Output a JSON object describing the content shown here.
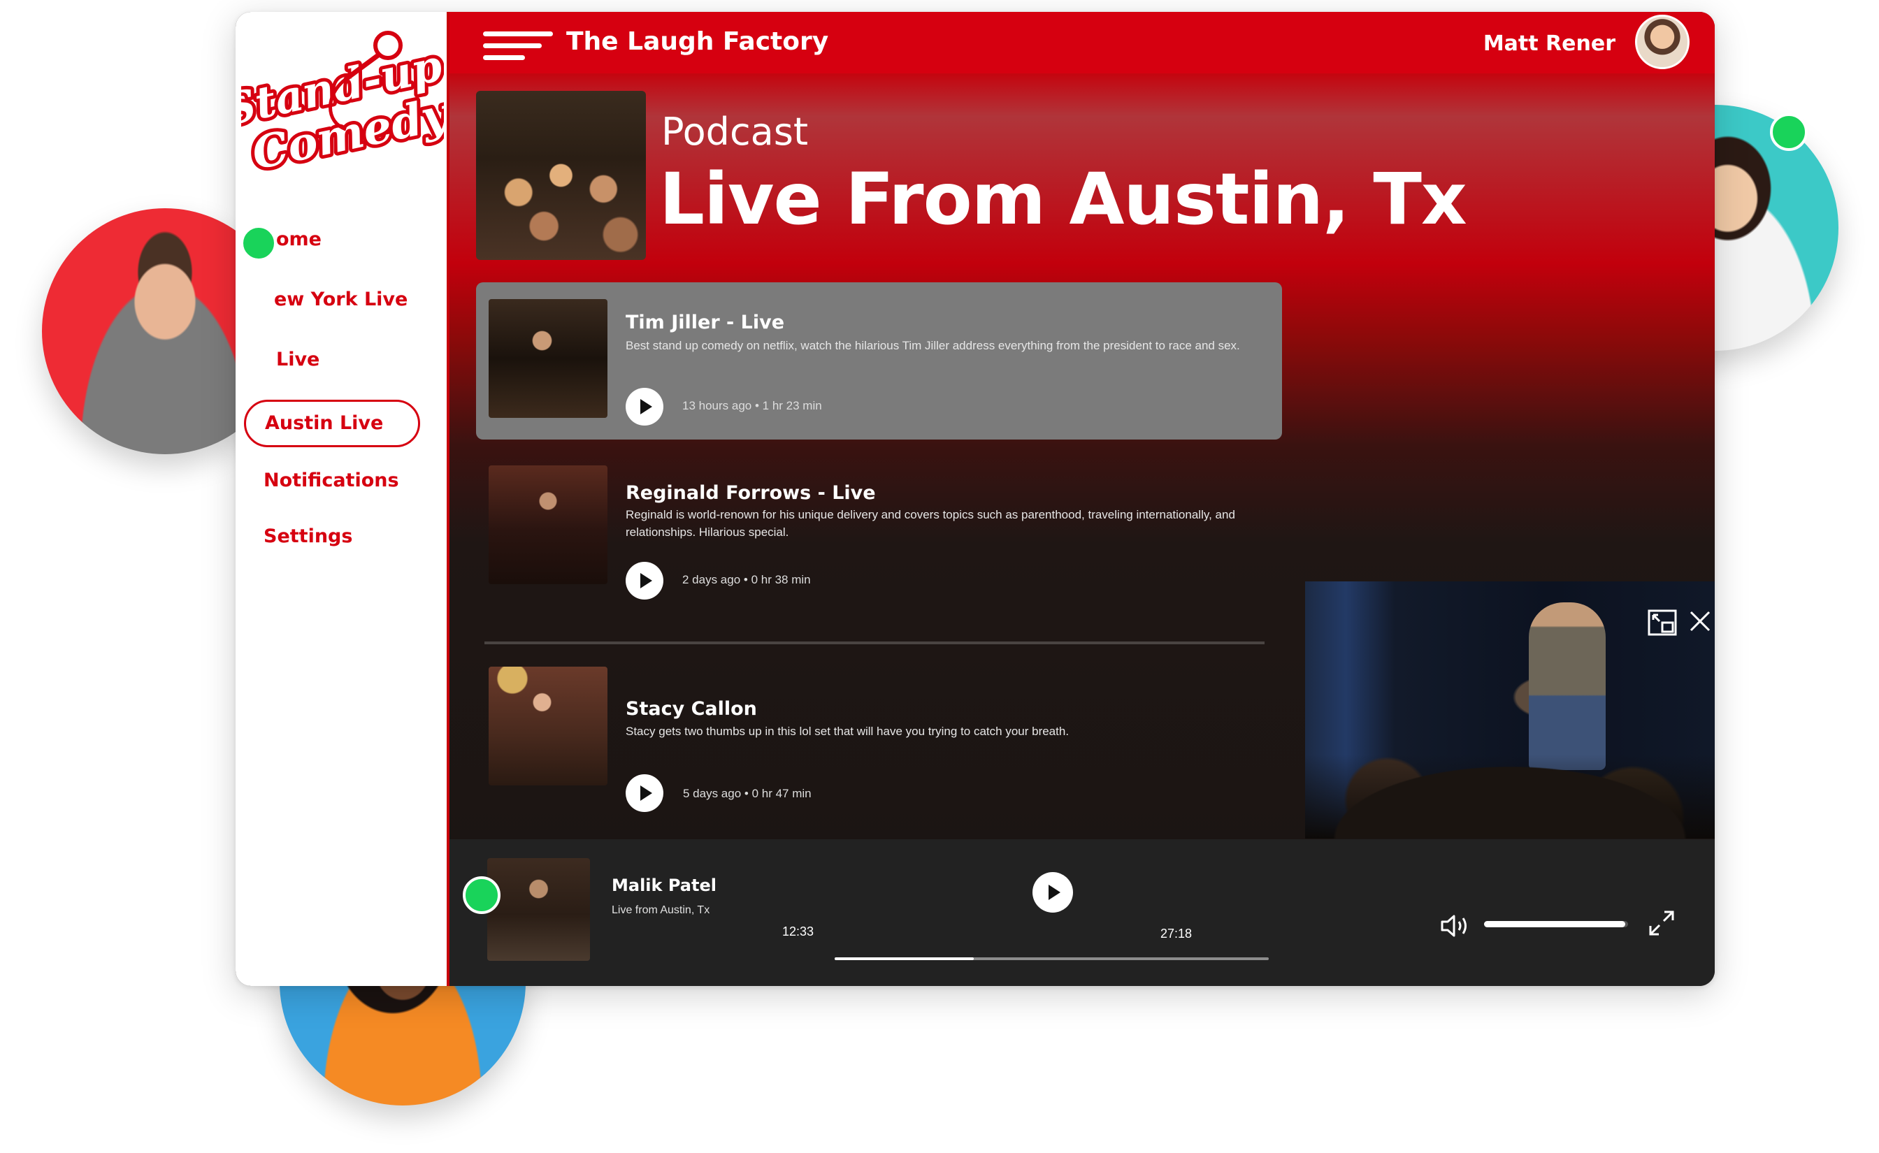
{
  "app": {
    "title": "The Laugh Factory",
    "logo_text_1": "Stand-up",
    "logo_text_2": "Comedy"
  },
  "user": {
    "name": "Matt Rener"
  },
  "sidebar": {
    "items": [
      {
        "label": "ome"
      },
      {
        "label": "ew York Live"
      },
      {
        "label": "Live"
      },
      {
        "label": "Austin Live"
      },
      {
        "label": "Notifications"
      },
      {
        "label": "Settings"
      }
    ]
  },
  "hero": {
    "kicker": "Podcast",
    "title": "Live From Austin, Tx"
  },
  "episodes": [
    {
      "title": "Tim Jiller - Live",
      "description": "Best stand up comedy on netflix, watch the hilarious Tim Jiller address everything from the president to race and sex.",
      "meta": "13 hours ago • 1 hr 23 min"
    },
    {
      "title": "Reginald Forrows - Live",
      "description": "Reginald is world-renown for his unique delivery and covers topics such as parenthood, traveling internationally, and relationships. Hilarious special.",
      "meta": "2 days ago •  0 hr 38 min"
    },
    {
      "title": "Stacy Callon",
      "description": "Stacy gets two thumbs up in this lol set that will have you trying to catch your breath.",
      "meta": "5 days ago • 0 hr 47 min"
    }
  ],
  "player": {
    "name": "Malik Patel",
    "subtitle": "Live from Austin, Tx",
    "elapsed": "12:33",
    "total": "27:18",
    "progress_fraction": 0.32,
    "volume_fraction": 0.98
  },
  "colors": {
    "brand_red": "#d60010",
    "online_green": "#19d35a",
    "player_bg": "#222222"
  },
  "icons": [
    "menu-icon",
    "play-icon",
    "picture-in-picture-icon",
    "close-icon",
    "volume-icon",
    "expand-icon"
  ]
}
